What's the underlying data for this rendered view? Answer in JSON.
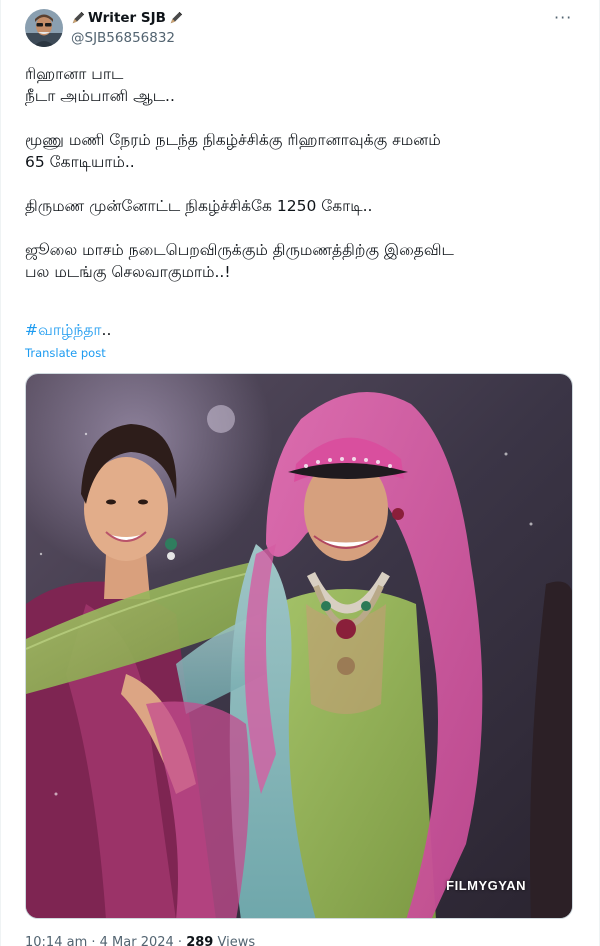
{
  "author": {
    "display_name": "Writer SJB",
    "handle": "@SJB56856832"
  },
  "tweet": {
    "lines": [
      [
        "ரிஹானா பாட",
        "நீடா அம்பானி ஆட.."
      ],
      [
        "மூணு மணி நேரம் நடந்த நிகழ்ச்சிக்கு ரிஹானாவுக்கு சமனம்",
        "65 கோடியாம்.."
      ],
      [
        "திருமண முன்னோட்ட நிகழ்ச்சிக்கே 1250 கோடி.."
      ],
      [
        "ஜூலை மாசம் நடைபெறவிருக்கும் திருமணத்திற்கு இதைவிட",
        "பல மடங்கு செலவாகுமாம்..!"
      ]
    ],
    "hashtag": "#வாழ்ந்தா",
    "hashtag_tail": "..",
    "translate_label": "Translate post"
  },
  "media": {
    "watermark": "FILMYGYAN"
  },
  "meta": {
    "time": "10:14 am",
    "date": "4 Mar 2024",
    "views_count": "289",
    "views_label": "Views"
  },
  "icons": {
    "more": "more-icon",
    "pen": "pen-icon"
  },
  "colors": {
    "link": "#1d9bf0",
    "text": "#0f1419",
    "secondary": "#536471"
  }
}
